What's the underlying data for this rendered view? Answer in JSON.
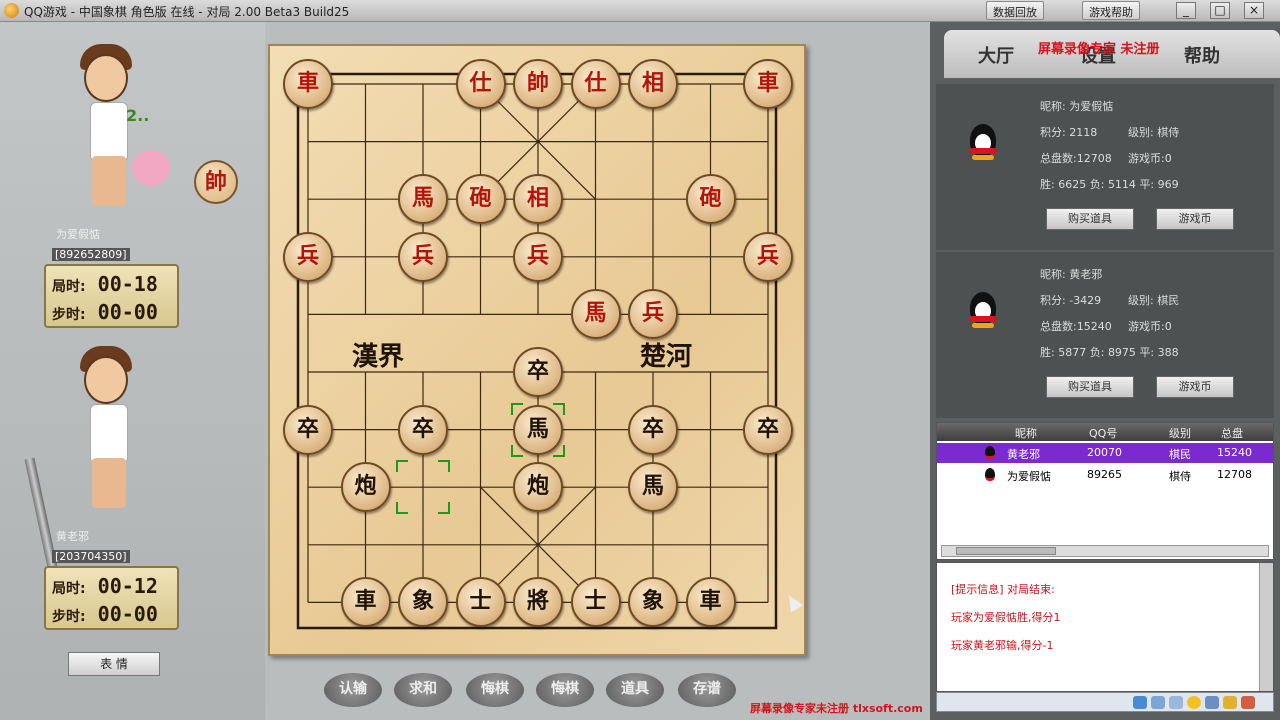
{
  "window": {
    "title": "QQ游戏 - 中国象棋 角色版 在线 - 对局 2.00 Beta3 Build25",
    "toolbar_left_label": "数据回放",
    "toolbar_right_label": "游戏帮助",
    "minimize": "_",
    "restore": "□",
    "close": "×"
  },
  "left_panel": {
    "top_player": {
      "name": "为爱假惦",
      "id": "[892652809]",
      "game_time_label": "局时:",
      "game_time": "00-18",
      "step_time_label": "步时:",
      "step_time": "00-00",
      "thinking": "2..",
      "side_piece": "帥"
    },
    "bottom_player": {
      "name": "黄老邪",
      "id": "[203704350]",
      "game_time_label": "局时:",
      "game_time": "00-12",
      "step_time_label": "步时:",
      "step_time": "00-00"
    },
    "emote_button": "表 情"
  },
  "board": {
    "river_left": "漢界",
    "river_right": "楚河",
    "pieces": [
      {
        "char": "車",
        "color": "red",
        "col": 0,
        "row": 0
      },
      {
        "char": "仕",
        "color": "red",
        "col": 3,
        "row": 0
      },
      {
        "char": "帥",
        "color": "red",
        "col": 4,
        "row": 0
      },
      {
        "char": "仕",
        "color": "red",
        "col": 5,
        "row": 0
      },
      {
        "char": "相",
        "color": "red",
        "col": 6,
        "row": 0
      },
      {
        "char": "車",
        "color": "red",
        "col": 8,
        "row": 0
      },
      {
        "char": "馬",
        "color": "red",
        "col": 2,
        "row": 2
      },
      {
        "char": "砲",
        "color": "red",
        "col": 3,
        "row": 2
      },
      {
        "char": "相",
        "color": "red",
        "col": 4,
        "row": 2
      },
      {
        "char": "砲",
        "color": "red",
        "col": 7,
        "row": 2
      },
      {
        "char": "兵",
        "color": "red",
        "col": 0,
        "row": 3
      },
      {
        "char": "兵",
        "color": "red",
        "col": 2,
        "row": 3
      },
      {
        "char": "兵",
        "color": "red",
        "col": 4,
        "row": 3
      },
      {
        "char": "兵",
        "color": "red",
        "col": 8,
        "row": 3
      },
      {
        "char": "馬",
        "color": "red",
        "col": 5,
        "row": 4
      },
      {
        "char": "兵",
        "color": "red",
        "col": 6,
        "row": 4
      },
      {
        "char": "卒",
        "color": "black",
        "col": 4,
        "row": 5
      },
      {
        "char": "卒",
        "color": "black",
        "col": 0,
        "row": 6
      },
      {
        "char": "卒",
        "color": "black",
        "col": 2,
        "row": 6
      },
      {
        "char": "馬",
        "color": "black",
        "col": 4,
        "row": 6
      },
      {
        "char": "卒",
        "color": "black",
        "col": 6,
        "row": 6
      },
      {
        "char": "卒",
        "color": "black",
        "col": 8,
        "row": 6
      },
      {
        "char": "炮",
        "color": "black",
        "col": 1,
        "row": 7
      },
      {
        "char": "炮",
        "color": "black",
        "col": 4,
        "row": 7
      },
      {
        "char": "馬",
        "color": "black",
        "col": 6,
        "row": 7
      },
      {
        "char": "車",
        "color": "black",
        "col": 1,
        "row": 9
      },
      {
        "char": "象",
        "color": "black",
        "col": 2,
        "row": 9
      },
      {
        "char": "士",
        "color": "black",
        "col": 3,
        "row": 9
      },
      {
        "char": "將",
        "color": "black",
        "col": 4,
        "row": 9
      },
      {
        "char": "士",
        "color": "black",
        "col": 5,
        "row": 9
      },
      {
        "char": "象",
        "color": "black",
        "col": 6,
        "row": 9
      },
      {
        "char": "車",
        "color": "black",
        "col": 7,
        "row": 9
      }
    ],
    "selection": [
      {
        "col": 4,
        "row": 6
      },
      {
        "col": 2,
        "row": 7
      }
    ]
  },
  "bottom_toolbar": [
    "认输",
    "求和",
    "悔棋",
    "悔棋",
    "道具",
    "存谱"
  ],
  "right_panel": {
    "tabs": [
      "大厅",
      "设置",
      "帮助"
    ],
    "watermark_top": "屏幕录像专家 未注册",
    "players": [
      {
        "nick_label": "昵称:",
        "nick": "为爱假惦",
        "score_label": "积分:",
        "score": "2118",
        "level_label": "级别:",
        "level": "棋侍",
        "total_label": "总盘数:",
        "total": "12708",
        "coins_label": "游戏币:",
        "coins": "0",
        "win_label": "胜:",
        "win": "6625",
        "lose_label": "负:",
        "lose": "5114",
        "draw_label": "平:",
        "draw": "969",
        "btn_props": "购买道具",
        "btn_coins": "游戏币"
      },
      {
        "nick_label": "昵称:",
        "nick": "黄老邪",
        "score_label": "积分:",
        "score": "-3429",
        "level_label": "级别:",
        "level": "棋民",
        "total_label": "总盘数:",
        "total": "15240",
        "coins_label": "游戏币:",
        "coins": "0",
        "win_label": "胜:",
        "win": "5877",
        "lose_label": "负:",
        "lose": "8975",
        "draw_label": "平:",
        "draw": "388",
        "btn_props": "购买道具",
        "btn_coins": "游戏币"
      }
    ],
    "list_headers": [
      "昵称",
      "QQ号",
      "级别",
      "总盘"
    ],
    "list_rows": [
      {
        "name": "黄老邪",
        "qq": "20070",
        "level": "棋民",
        "total": "15240",
        "selected": true
      },
      {
        "name": "为爱假惦",
        "qq": "89265",
        "level": "棋侍",
        "total": "12708",
        "selected": false
      }
    ],
    "messages": [
      "[提示信息] 对局结束:",
      "玩家为爱假惦胜,得分1",
      "玩家黄老邪输,得分-1"
    ]
  },
  "watermark_bottom": "屏幕录像专家未注册 tlxsoft.com"
}
